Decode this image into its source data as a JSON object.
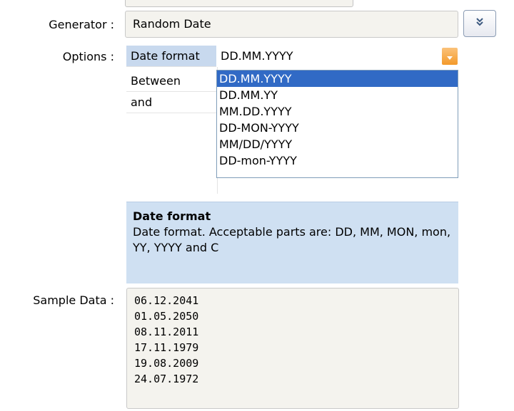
{
  "generator": {
    "label": "Generator :",
    "value": "Random Date",
    "expand_icon": "double-chevron-down-icon"
  },
  "options": {
    "label": "Options :",
    "rows": [
      {
        "name": "Date format",
        "value": "DD.MM.YYYY",
        "selected": true
      },
      {
        "name": "Between",
        "value": ""
      },
      {
        "name": "and",
        "value": ""
      }
    ],
    "dropdown_items": [
      "DD.MM.YYYY",
      "DD.MM.YY",
      "MM.DD.YYYY",
      "DD-MON-YYYY",
      "MM/DD/YYYY",
      "DD-mon-YYYY"
    ],
    "dropdown_highlighted": "DD.MM.YYYY",
    "dropdown_arrow_color": "#f39a2b"
  },
  "description": {
    "title": "Date format",
    "body": "Date format. Acceptable parts are: DD, MM, MON, mon, YY, YYYY and C"
  },
  "sample": {
    "label": "Sample Data :",
    "lines": [
      "06.12.2041",
      "01.05.2050",
      "08.11.2011",
      "17.11.1979",
      "19.08.2009",
      "24.07.1972"
    ]
  },
  "colors": {
    "selection": "#316ac5",
    "description_bg": "#cfe0f2",
    "field_bg": "#f4f3ee"
  }
}
